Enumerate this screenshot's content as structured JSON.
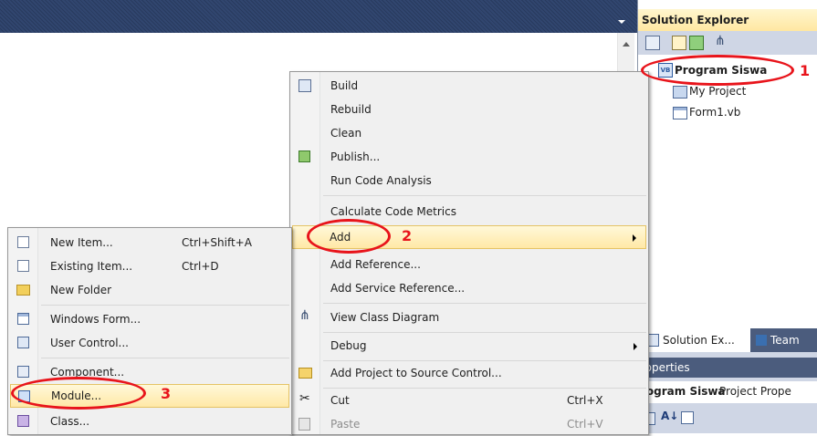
{
  "solution_explorer": {
    "title": "Solution Explorer",
    "tree": [
      {
        "label": "Program Siswa"
      },
      {
        "label": "My Project"
      },
      {
        "label": "Form1.vb"
      }
    ],
    "tabs": [
      "Solution Ex...",
      "Team"
    ]
  },
  "properties": {
    "title": "roperties",
    "object_name": "rogram Siswa",
    "object_type": "Project Prope"
  },
  "context_menu": {
    "items": [
      {
        "label": "Build",
        "icon": "build-icon"
      },
      {
        "label": "Rebuild"
      },
      {
        "label": "Clean"
      },
      {
        "label": "Publish...",
        "icon": "publish-icon"
      },
      {
        "label": "Run Code Analysis"
      },
      {
        "label": "Calculate Code Metrics"
      },
      {
        "label": "Add"
      },
      {
        "label": "Add Reference..."
      },
      {
        "label": "Add Service Reference..."
      },
      {
        "label": "View Class Diagram",
        "icon": "class-diagram-icon"
      },
      {
        "label": "Debug"
      },
      {
        "label": "Add Project to Source Control...",
        "icon": "source-control-icon"
      },
      {
        "label": "Cut",
        "shortcut": "Ctrl+X",
        "icon": "scissors-icon"
      },
      {
        "label": "Paste",
        "shortcut": "Ctrl+V",
        "icon": "paste-icon"
      }
    ]
  },
  "add_submenu": {
    "items": [
      {
        "label": "New Item...",
        "shortcut": "Ctrl+Shift+A"
      },
      {
        "label": "Existing Item...",
        "shortcut": "Ctrl+D"
      },
      {
        "label": "New Folder"
      },
      {
        "label": "Windows Form..."
      },
      {
        "label": "User Control..."
      },
      {
        "label": "Component..."
      },
      {
        "label": "Module..."
      },
      {
        "label": "Class..."
      }
    ]
  },
  "annotations": [
    "1",
    "2",
    "3"
  ],
  "colors": {
    "title_bar": "#293955",
    "highlight": "#ffe8a6",
    "annotation": "#e8141b"
  }
}
